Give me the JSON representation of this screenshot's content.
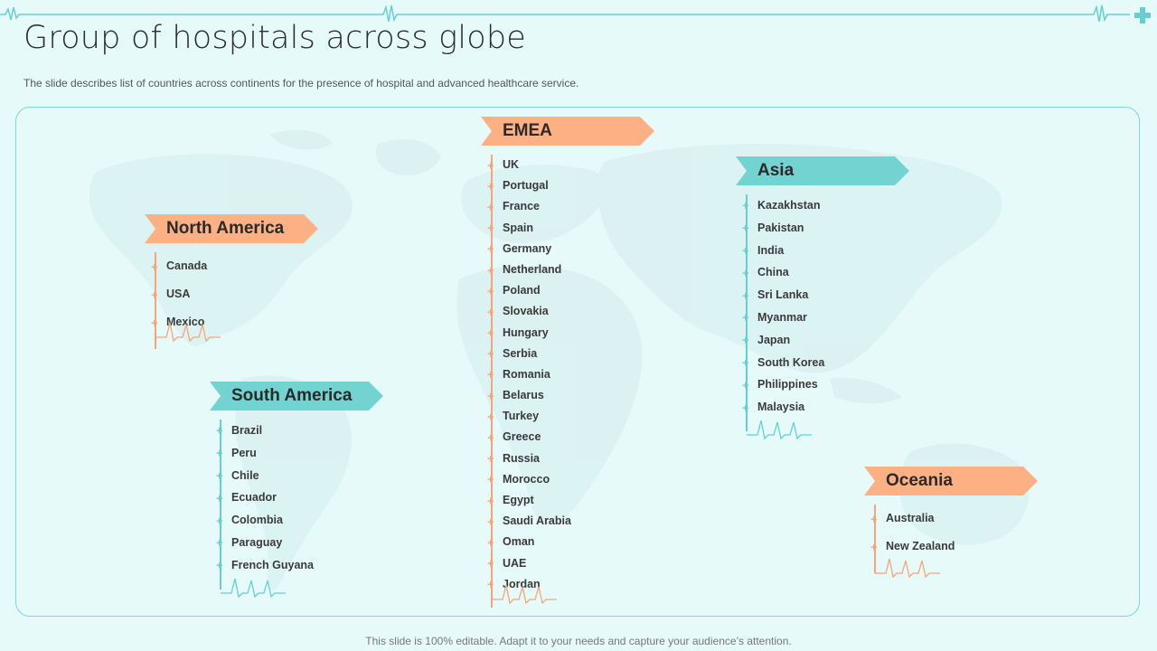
{
  "title": "Group of hospitals across globe",
  "subtitle": "The slide describes list of countries across continents for the presence of hospital and advanced healthcare service.",
  "footer": "This slide is 100% editable. Adapt it to your needs and capture your audience’s attention.",
  "colors": {
    "orange": "#fdb083",
    "teal": "#72d3d1",
    "background": "#e6fafa",
    "frame": "#7ed6d6"
  },
  "icons": [
    "heartbeat-line-icon",
    "plus-icon",
    "world-map-icon"
  ],
  "regions": {
    "north_america": {
      "name": "North America",
      "countries": [
        "Canada",
        "USA",
        "Mexico"
      ]
    },
    "south_america": {
      "name": "South America",
      "countries": [
        "Brazil",
        "Peru",
        "Chile",
        "Ecuador",
        "Colombia",
        "Paraguay",
        "French Guyana"
      ]
    },
    "emea": {
      "name": "EMEA",
      "countries": [
        "UK",
        "Portugal",
        "France",
        "Spain",
        "Germany",
        "Netherland",
        "Poland",
        "Slovakia",
        "Hungary",
        "Serbia",
        "Romania",
        "Belarus",
        "Turkey",
        "Greece",
        "Russia",
        "Morocco",
        "Egypt",
        "Saudi Arabia",
        "Oman",
        "UAE",
        "Jordan"
      ]
    },
    "asia": {
      "name": "Asia",
      "countries": [
        "Kazakhstan",
        "Pakistan",
        "India",
        "China",
        "Sri Lanka",
        "Myanmar",
        "Japan",
        "South Korea",
        "Philippines",
        "Malaysia"
      ]
    },
    "oceania": {
      "name": "Oceania",
      "countries": [
        "Australia",
        "New Zealand"
      ]
    }
  }
}
